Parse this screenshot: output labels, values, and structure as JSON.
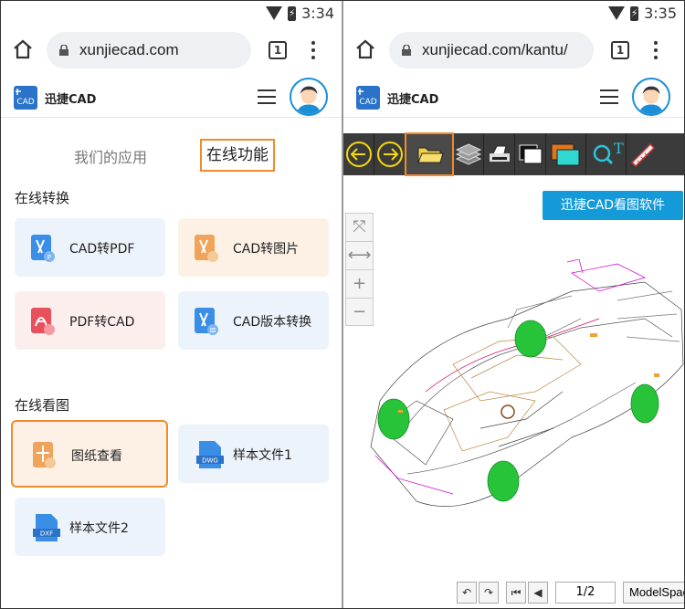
{
  "left": {
    "status": {
      "time": "3:34"
    },
    "browser": {
      "url": "xunjiecad.com",
      "tab_count": "1"
    },
    "site": {
      "brand": "迅捷CAD"
    },
    "tabs": [
      {
        "label": "我们的应用"
      },
      {
        "label": "在线功能"
      }
    ],
    "sections": [
      {
        "title": "在线转换",
        "cards": [
          {
            "label": "CAD转PDF"
          },
          {
            "label": "CAD转图片"
          },
          {
            "label": "PDF转CAD"
          },
          {
            "label": "CAD版本转换"
          }
        ]
      },
      {
        "title": "在线看图",
        "cards": [
          {
            "label": "图纸查看"
          },
          {
            "label": "样本文件1"
          },
          {
            "label": "样本文件2"
          }
        ]
      }
    ]
  },
  "right": {
    "status": {
      "time": "3:35"
    },
    "browser": {
      "url": "xunjiecad.com/kantu/",
      "tab_count": "1"
    },
    "site": {
      "brand": "迅捷CAD"
    },
    "toolbar": [
      {
        "icon": "back-arrow-icon"
      },
      {
        "icon": "forward-arrow-icon"
      },
      {
        "icon": "open-folder-icon",
        "selected": true
      },
      {
        "icon": "layers-icon"
      },
      {
        "icon": "print-icon"
      },
      {
        "icon": "black-background-icon"
      },
      {
        "icon": "color-background-icon"
      },
      {
        "icon": "text-search-icon"
      },
      {
        "icon": "measure-icon"
      }
    ],
    "viewer_button": "迅捷CAD看图软件",
    "zoom_controls": [
      "⤧",
      "⟷",
      "+",
      "−"
    ],
    "bottom_nav": {
      "page": "1/2",
      "space": "ModelSpace"
    }
  },
  "colors": {
    "accent_orange": "#ef8b2c",
    "brand_blue": "#159ad9",
    "toolbar_dark": "#3b3b3b"
  }
}
